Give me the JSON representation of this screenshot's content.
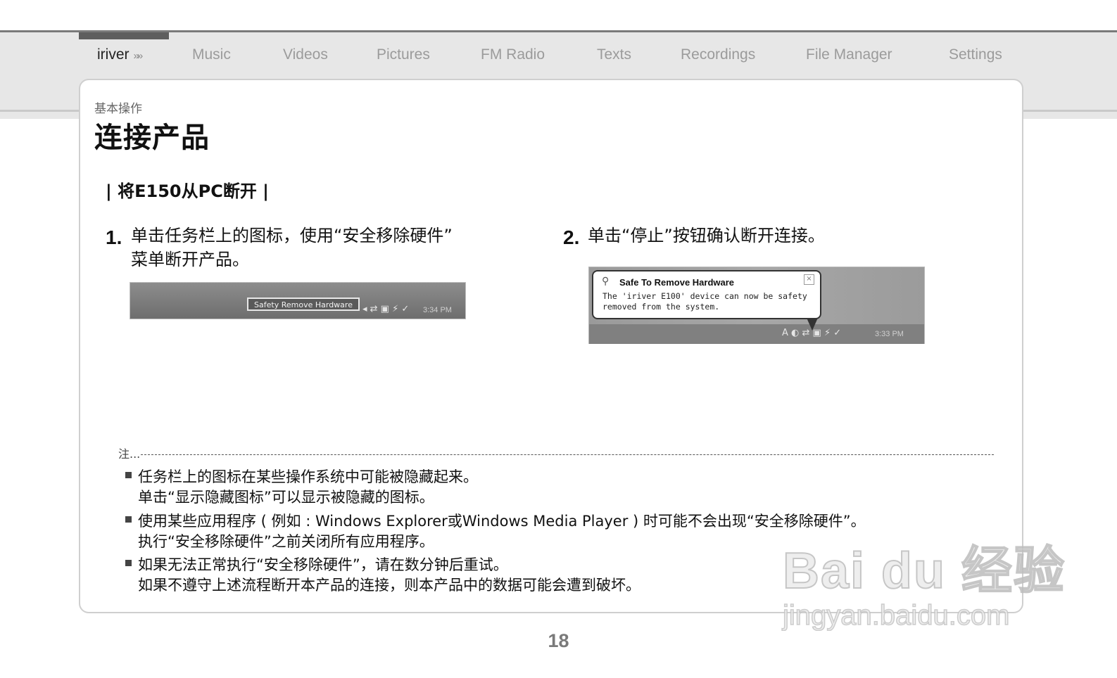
{
  "nav": {
    "items": [
      {
        "label": "iriver",
        "arrows": "»»"
      },
      {
        "label": "Music"
      },
      {
        "label": "Videos"
      },
      {
        "label": "Pictures"
      },
      {
        "label": "FM Radio"
      },
      {
        "label": "Texts"
      },
      {
        "label": "Recordings"
      },
      {
        "label": "File Manager"
      },
      {
        "label": "Settings"
      }
    ]
  },
  "page": {
    "section": "基本操作",
    "title": "连接产品",
    "subheading": "| 将E150从PC断开 |",
    "page_number": "18"
  },
  "steps": [
    {
      "num": "1.",
      "lines": [
        "单击任务栏上的图标，使用“安全移除硬件”",
        "菜单断开产品。"
      ]
    },
    {
      "num": "2.",
      "lines": [
        "单击“停止”按钮确认断开连接。"
      ]
    }
  ],
  "screenshot1": {
    "tooltip": "Safety Remove Hardware",
    "tray_icons": "◂ ⇄ ▣ ⚡ ✓",
    "time": "3:34 PM"
  },
  "screenshot2": {
    "balloon_title": "Safe To Remove Hardware",
    "balloon_close": "×",
    "balloon_lines": [
      "The 'iriver E100' device can now be safety",
      "removed from the system."
    ],
    "tray_icons": "A ◐ ⇄ ▣ ⚡ ✓",
    "time": "3:33 PM"
  },
  "note": {
    "label": "注...",
    "items": [
      {
        "lines": [
          "任务栏上的图标在某些操作系统中可能被隐藏起来。",
          "单击“显示隐藏图标”可以显示被隐藏的图标。"
        ]
      },
      {
        "lines": [
          "使用某些应用程序 ( 例如 : Windows Explorer或Windows Media Player ) 时可能不会出现“安全移除硬件”。",
          "执行“安全移除硬件”之前关闭所有应用程序。"
        ]
      },
      {
        "lines": [
          "如果无法正常执行“安全移除硬件”，请在数分钟后重试。",
          "如果不遵守上述流程断开本产品的连接，则本产品中的数据可能会遭到破坏。"
        ]
      }
    ]
  },
  "watermark": {
    "main": "Bai du 经验",
    "sub": "jingyan.baidu.com"
  }
}
